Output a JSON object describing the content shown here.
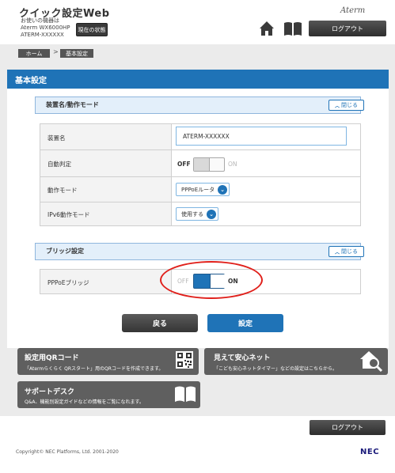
{
  "header": {
    "app_title": "クイック設定Web",
    "device_line1": "お使いの機器は",
    "device_line2": "Aterm WX6000HP",
    "device_line3": "ATERM-XXXXXX",
    "status_button_label": "現在の状態",
    "brand": "Aterm",
    "home_icon": "home-icon",
    "book_icon": "book-icon",
    "logout_label": "ログアウト"
  },
  "breadcrumb": {
    "home": "ホーム",
    "separator": ">",
    "current": "基本設定"
  },
  "page": {
    "title": "基本設定"
  },
  "section_device": {
    "title": "装置名/動作モード",
    "close_label": "閉じる",
    "rows": {
      "device_name": {
        "label": "装置名",
        "value": "ATERM-XXXXXX"
      },
      "auto_detect": {
        "label": "自動判定",
        "off_label": "OFF",
        "on_label": "ON",
        "state": "off"
      },
      "operation_mode": {
        "label": "動作モード",
        "selected": "PPPoEルータ"
      },
      "ipv6_mode": {
        "label": "IPv6動作モード",
        "selected": "使用する"
      }
    }
  },
  "section_bridge": {
    "title": "ブリッジ設定",
    "close_label": "閉じる",
    "rows": {
      "pppoe_bridge": {
        "label": "PPPoEブリッジ",
        "off_label": "OFF",
        "on_label": "ON",
        "state": "on"
      }
    }
  },
  "actions": {
    "back_label": "戻る",
    "save_label": "設定"
  },
  "cards": {
    "qr": {
      "title": "設定用QRコード",
      "description": "「Atermらくらく QRスタート」用のQRコードを作成できます。",
      "icon": "qr-code-icon"
    },
    "safety_net": {
      "title": "見えて安心ネット",
      "description": "「こども安心ネットタイマー」などの設定はこちらから。",
      "icon": "house-search-icon"
    },
    "support": {
      "title": "サポートデスク",
      "description": "Q&A、機能別設定ガイドなどの情報をご覧になれます。",
      "icon": "open-book-icon"
    }
  },
  "footer": {
    "logout_label": "ログアウト",
    "copyright": "Copyright© NEC Platforms, Ltd. 2001-2020",
    "logo": "NEC"
  },
  "colors": {
    "accent_blue": "#1f73b7",
    "section_header_bg": "#e3effa",
    "highlight_red": "#e0201b",
    "dark_button": "#353535"
  }
}
